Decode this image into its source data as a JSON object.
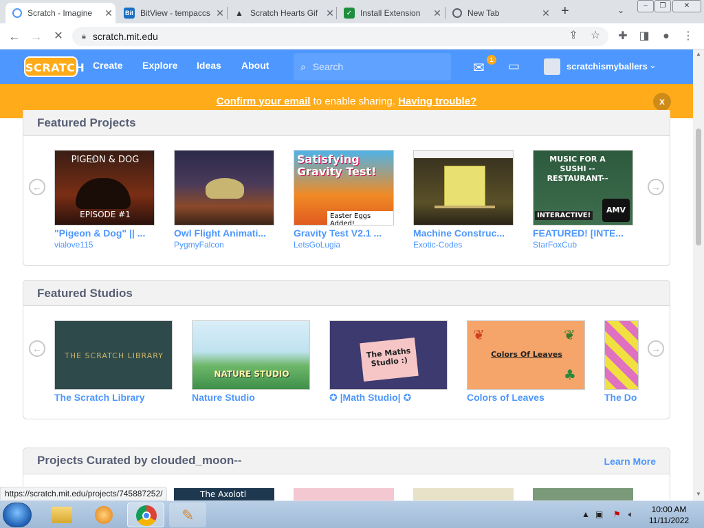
{
  "browser": {
    "tabs": [
      {
        "title": "Scratch - Imagine",
        "active": true,
        "icon": "scratch-favicon"
      },
      {
        "title": "BitView - tempaccs",
        "active": false,
        "icon": "bitview-favicon"
      },
      {
        "title": "Scratch Hearts Gif",
        "active": false,
        "icon": "image-favicon"
      },
      {
        "title": "Install Extension",
        "active": false,
        "icon": "shield-favicon"
      },
      {
        "title": "New Tab",
        "active": false,
        "icon": "chrome-favicon"
      }
    ],
    "url": "scratch.mit.edu",
    "new_tab_icon": "+",
    "status_url": "https://scratch.mit.edu/projects/745887252/"
  },
  "nav": {
    "logo": "SCRATCH",
    "links": [
      "Create",
      "Explore",
      "Ideas",
      "About"
    ],
    "search_placeholder": "Search",
    "message_count": "1",
    "username": "scratchismyballers"
  },
  "banner": {
    "confirm_link": "Confirm your email",
    "middle_text": " to enable sharing. ",
    "trouble_link": "Having trouble?",
    "close": "x"
  },
  "featured_projects": {
    "heading": "Featured Projects",
    "items": [
      {
        "title": "\"Pigeon & Dog\" || ...",
        "author": "vialove115",
        "thumb_top": "PIGEON & DOG",
        "thumb_bottom": "EPISODE #1"
      },
      {
        "title": "Owl Flight Animati...",
        "author": "PygmyFalcon"
      },
      {
        "title": "Gravity Test V2.1 ...",
        "author": "LetsGoLugia",
        "thumb_top": "Satisfying Gravity Test!",
        "thumb_bottom": "Easter Eggs Added!"
      },
      {
        "title": "Machine Construc...",
        "author": "Exotic-Codes"
      },
      {
        "title": "FEATURED! [INTE...",
        "author": "StarFoxCub",
        "thumb_top": "MUSIC FOR A SUSHI --RESTAURANT--",
        "thumb_bottom": "INTERACTIVE!",
        "thumb_tag": "AMV"
      }
    ]
  },
  "featured_studios": {
    "heading": "Featured Studios",
    "items": [
      {
        "title": "The Scratch Library",
        "thumb_text": "THE SCRATCH LIBRARY"
      },
      {
        "title": "Nature Studio",
        "thumb_text": "NATURE STUDIO"
      },
      {
        "title": "✪ |Math Studio| ✪",
        "thumb_text": "The Maths Studio :)"
      },
      {
        "title": "Colors of Leaves",
        "thumb_text": "Colors Of Leaves"
      },
      {
        "title": "The Do",
        "thumb_text": ""
      }
    ]
  },
  "curated": {
    "heading": "Projects Curated by clouded_moon--",
    "learn_more": "Learn More",
    "thumb_text": "The Axolotl"
  },
  "taskbar": {
    "time": "10:00 AM",
    "date": "11/11/2022"
  },
  "colors": {
    "scratch_blue": "#4d97ff",
    "banner_orange": "#ffab1a",
    "link_blue": "#4d97ff"
  }
}
